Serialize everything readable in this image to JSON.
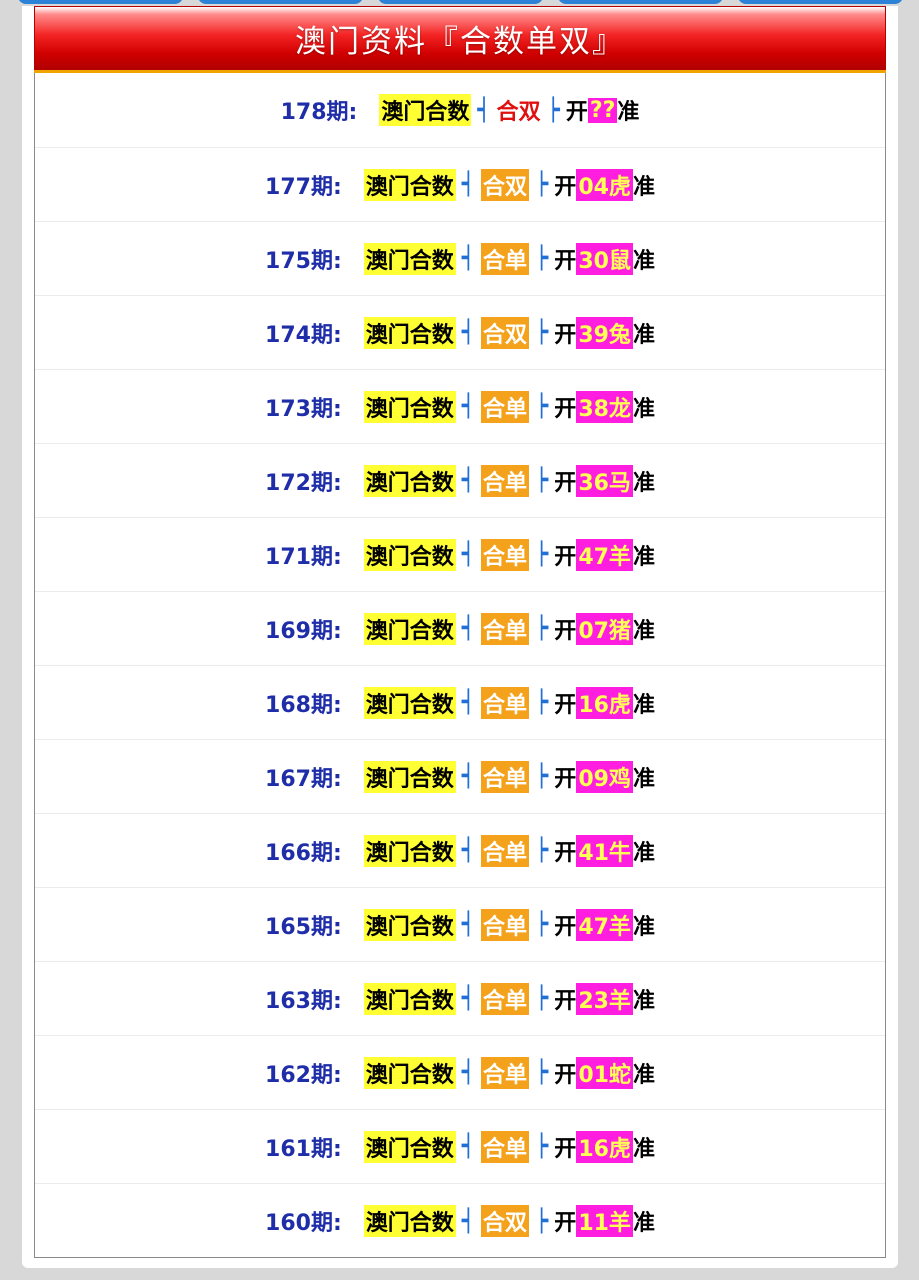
{
  "header": {
    "title": "澳门资料『合数单双』"
  },
  "labels": {
    "source": "澳门合数",
    "bracket_open": "┥",
    "bracket_close": "┝",
    "open": "开",
    "accurate": "准"
  },
  "colors": {
    "header_red": "#d00000",
    "period_blue": "#1f2ea8",
    "source_bg": "#ffff33",
    "result_bg": "#f4a21c",
    "number_bg": "#ff1ee0",
    "number_text": "#ffff55",
    "bracket_blue": "#1f6fd6"
  },
  "rows": [
    {
      "period": "178期:",
      "result": "合双",
      "number": "??"
    },
    {
      "period": "177期:",
      "result": "合双",
      "number": "04虎"
    },
    {
      "period": "175期:",
      "result": "合单",
      "number": "30鼠"
    },
    {
      "period": "174期:",
      "result": "合双",
      "number": "39兔"
    },
    {
      "period": "173期:",
      "result": "合单",
      "number": "38龙"
    },
    {
      "period": "172期:",
      "result": "合单",
      "number": "36马"
    },
    {
      "period": "171期:",
      "result": "合单",
      "number": "47羊"
    },
    {
      "period": "169期:",
      "result": "合单",
      "number": "07猪"
    },
    {
      "period": "168期:",
      "result": "合单",
      "number": "16虎"
    },
    {
      "period": "167期:",
      "result": "合单",
      "number": "09鸡"
    },
    {
      "period": "166期:",
      "result": "合单",
      "number": "41牛"
    },
    {
      "period": "165期:",
      "result": "合单",
      "number": "47羊"
    },
    {
      "period": "163期:",
      "result": "合单",
      "number": "23羊"
    },
    {
      "period": "162期:",
      "result": "合单",
      "number": "01蛇"
    },
    {
      "period": "161期:",
      "result": "合单",
      "number": "16虎"
    },
    {
      "period": "160期:",
      "result": "合双",
      "number": "11羊"
    }
  ]
}
